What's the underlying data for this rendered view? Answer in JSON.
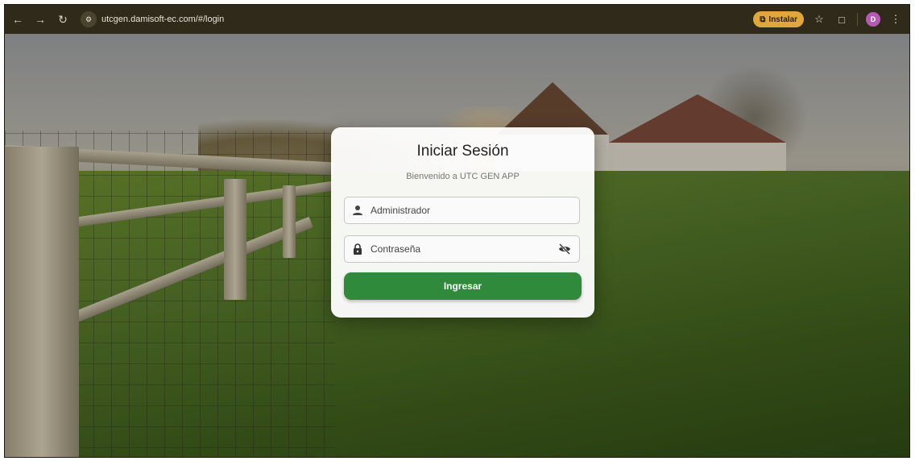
{
  "browser": {
    "url": "utcgen.damisoft-ec.com/#/login",
    "install_label": "Instalar",
    "profile_initial": "D"
  },
  "login": {
    "title": "Iniciar Sesión",
    "subtitle": "Bienvenido a UTC GEN APP",
    "username_placeholder": "Administrador",
    "password_placeholder": "Contraseña",
    "submit_label": "Ingresar"
  },
  "colors": {
    "accent": "#2f8a3c",
    "chrome": "#2f2a1a",
    "install": "#e0a83a"
  }
}
